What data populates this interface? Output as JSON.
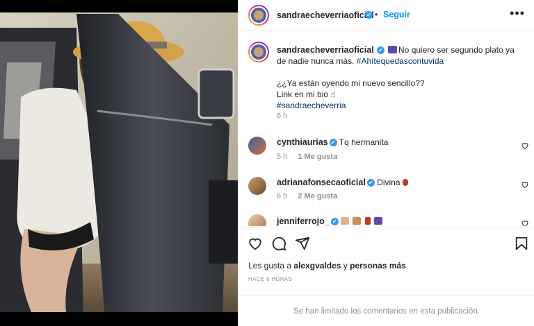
{
  "post": {
    "author": "sandraecheverriaoficial",
    "follow_label": "Seguir",
    "separator": "•",
    "more_label": "•••",
    "verified_mark": "✔",
    "caption_line1": "No quiero ser segundo plato ya de nadie nunca más.",
    "caption_hashtag1": "#Ahítequedascontuvida",
    "caption_line2": "¿¿Ya están oyendo mi nuevo sencillo??",
    "caption_line3": "Link en mi bio ☝",
    "caption_hashtag2": "#sandraecheverria",
    "caption_time": "6 h"
  },
  "comments": [
    {
      "user": "cynthiaurias",
      "text": "Tq hermanita",
      "time": "5 h",
      "likes": "1 Me gusta"
    },
    {
      "user": "adrianafonsecaoficial",
      "text": "Divina",
      "time": "6 h",
      "likes": "2 Me gusta"
    },
    {
      "user": "jenniferrojo_",
      "text": ""
    }
  ],
  "footer": {
    "likes_prefix": "Les gusta a",
    "likes_user": "alexgvaldes",
    "likes_and": "y",
    "likes_others": "personas más",
    "time_ago": "HACE 6 HORAS",
    "limited_notice": "Se han limitado los comentarios en esta publicación."
  },
  "icons": [
    "heart-icon",
    "comment-icon",
    "share-icon",
    "bookmark-icon",
    "more-icon",
    "verified-icon"
  ],
  "colors": {
    "link": "#0095f6",
    "hashtag": "#00376b",
    "muted": "#8e8e8e",
    "verified": "#3897f0"
  }
}
